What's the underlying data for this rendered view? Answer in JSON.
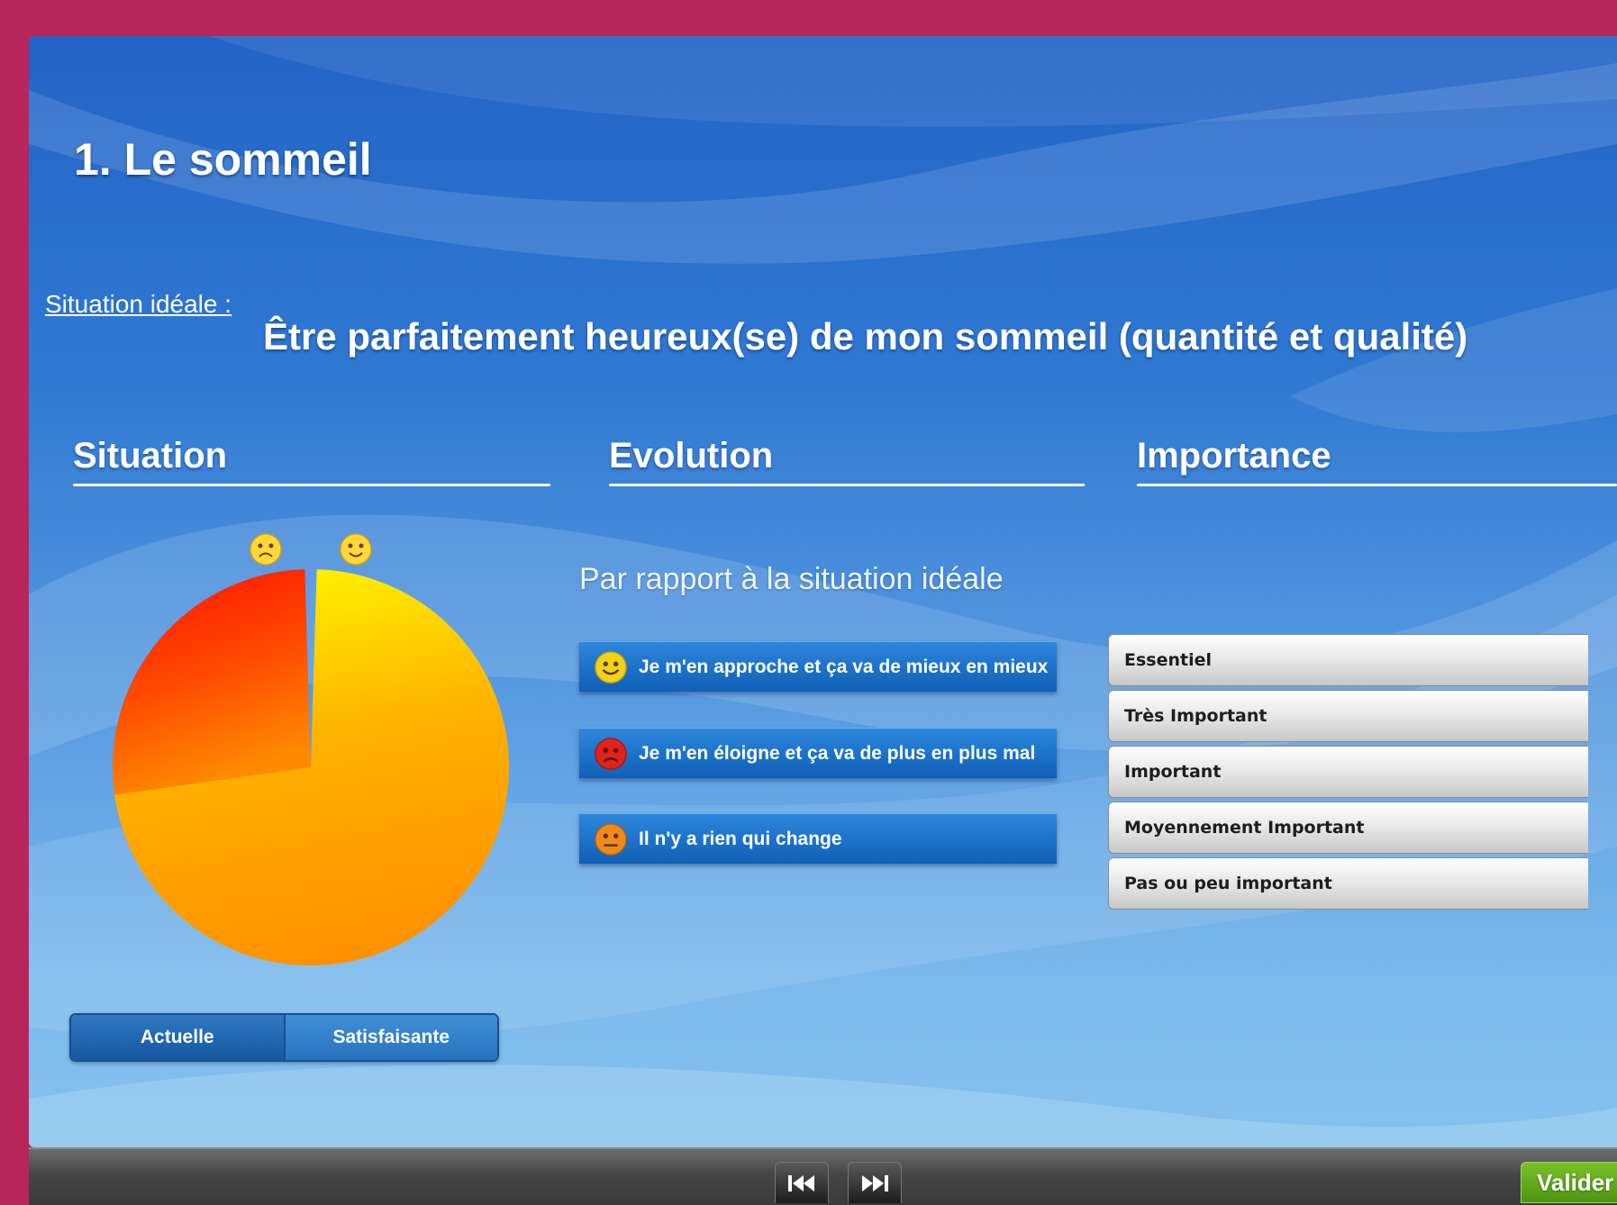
{
  "title": "1. Le sommeil",
  "ideal": {
    "label": "Situation idéale :",
    "text": "Être parfaitement heureux(se) de mon sommeil (quantité et qualité)"
  },
  "columns": {
    "situation": "Situation",
    "evolution": "Evolution",
    "importance": "Importance"
  },
  "situation": {
    "pie": {
      "red_fraction": 0.27,
      "yellow_fraction": 0.73
    },
    "sad_icon": "sad-face-icon",
    "happy_icon": "happy-face-icon",
    "segments": {
      "active": "Actuelle",
      "inactive": "Satisfaisante"
    }
  },
  "evolution": {
    "subtitle": "Par rapport à la situation idéale",
    "options": [
      {
        "label": "Je m'en approche et ça va de mieux en mieux",
        "icon": "happy-face-icon",
        "color": "#f2d21b"
      },
      {
        "label": "Je m'en éloigne et ça va de plus en plus mal",
        "icon": "sad-face-icon",
        "color": "#e0231c"
      },
      {
        "label": "Il n'y a rien qui change",
        "icon": "neutral-face-icon",
        "color": "#f08a1c"
      }
    ]
  },
  "importance": {
    "options": [
      "Essentiel",
      "Très Important",
      "Important",
      "Moyennement Important",
      "Pas ou peu important"
    ]
  },
  "footer": {
    "prev_icon": "skip-back-icon",
    "next_icon": "skip-forward-icon",
    "validate": "Valider"
  },
  "colors": {
    "page_frame": "#b8255a",
    "panel_top": "#2364c6",
    "pie_red": "#ff1a00",
    "pie_orange": "#ff8c00",
    "pie_yellow": "#ffee00",
    "validate_green": "#5eaa1c"
  }
}
